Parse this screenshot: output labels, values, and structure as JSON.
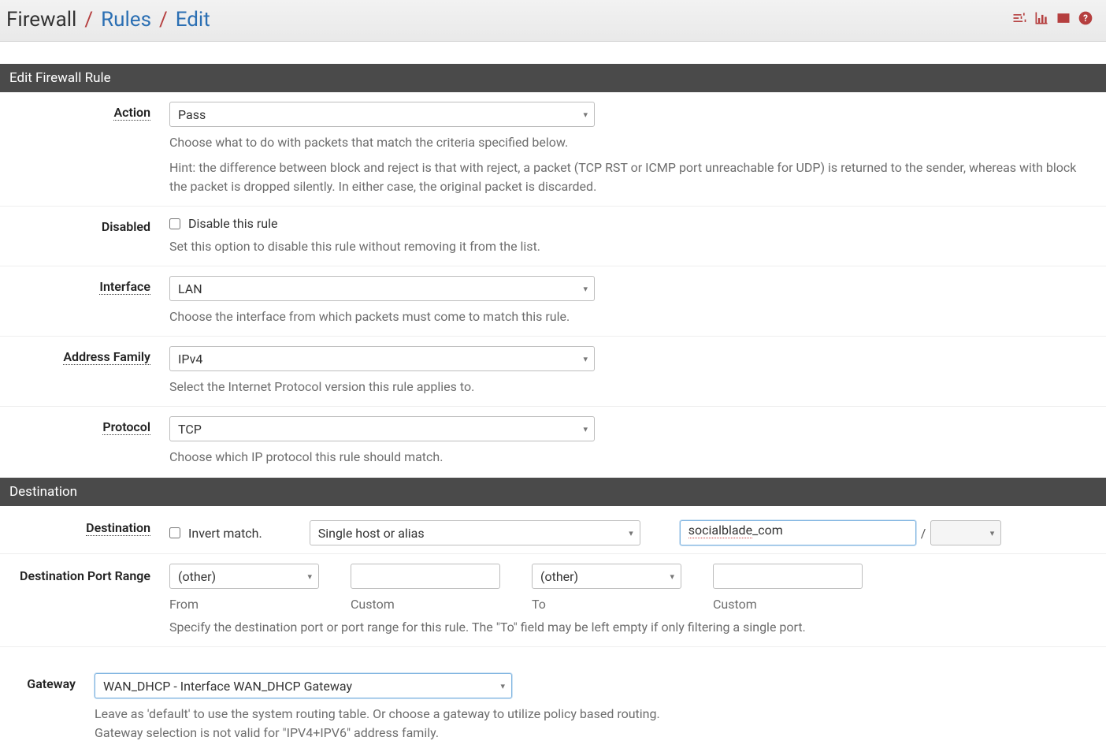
{
  "breadcrumb": {
    "first": "Firewall",
    "second": "Rules",
    "third": "Edit"
  },
  "icons": {
    "settings": "settings-icon",
    "stats": "stats-icon",
    "log": "log-icon",
    "help": "help-icon"
  },
  "panel1_title": "Edit Firewall Rule",
  "action": {
    "label": "Action",
    "value": "Pass",
    "help1": "Choose what to do with packets that match the criteria specified below.",
    "help2": "Hint: the difference between block and reject is that with reject, a packet (TCP RST or ICMP port unreachable for UDP) is returned to the sender, whereas with block the packet is dropped silently. In either case, the original packet is discarded."
  },
  "disabled": {
    "label": "Disabled",
    "checkbox_label": "Disable this rule",
    "help": "Set this option to disable this rule without removing it from the list."
  },
  "interface": {
    "label": "Interface",
    "value": "LAN",
    "help": "Choose the interface from which packets must come to match this rule."
  },
  "address_family": {
    "label": "Address Family",
    "value": "IPv4",
    "help": "Select the Internet Protocol version this rule applies to."
  },
  "protocol": {
    "label": "Protocol",
    "value": "TCP",
    "help": "Choose which IP protocol this rule should match."
  },
  "panel2_title": "Destination",
  "destination": {
    "label": "Destination",
    "invert_label": "Invert match.",
    "type_value": "Single host or alias",
    "address_value_prefix": "socialblade",
    "address_value_suffix": "_com",
    "slash": "/"
  },
  "dest_port": {
    "label": "Destination Port Range",
    "from_value": "(other)",
    "from_custom_value": "",
    "to_value": "(other)",
    "to_custom_value": "",
    "from_label": "From",
    "custom_label": "Custom",
    "to_label": "To",
    "help": "Specify the destination port or port range for this rule. The \"To\" field may be left empty if only filtering a single port."
  },
  "gateway": {
    "label": "Gateway",
    "value": "WAN_DHCP -                         Interface WAN_DHCP Gateway",
    "help1": "Leave as 'default' to use the system routing table. Or choose a gateway to utilize policy based routing.",
    "help2": "Gateway selection is not valid for \"IPV4+IPV6\" address family."
  }
}
